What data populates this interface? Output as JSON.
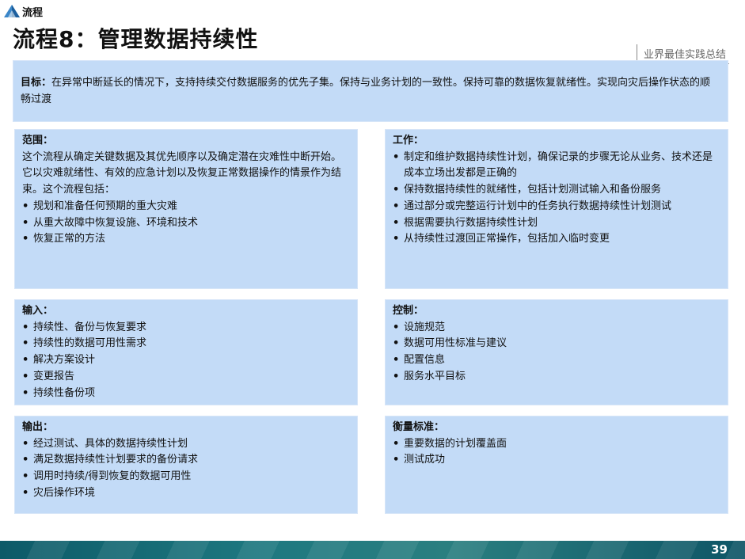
{
  "brand": {
    "text": "流程"
  },
  "title": "流程8：管理数据持续性",
  "best_practice_tag": "业界最佳实践总结",
  "goal": {
    "label": "目标：",
    "text": "在异常中断延长的情况下，支持持续交付数据服务的优先子集。保持与业务计划的一致性。保持可靠的数据恢复就绪性。实现向灾后操作状态的顺畅过渡"
  },
  "scope": {
    "label": "范围：",
    "text": "这个流程从确定关键数据及其优先顺序以及确定潜在灾难性中断开始。它以灾难就绪性、有效的应急计划以及恢复正常数据操作的情景作为结束。这个流程包括：",
    "items": [
      "规划和准备任何预期的重大灾难",
      "从重大故障中恢复设施、环境和技术",
      "恢复正常的方法"
    ]
  },
  "work": {
    "label": "工作：",
    "items": [
      "制定和维护数据持续性计划，确保记录的步骤无论从业务、技术还是成本立场出发都是正确的",
      "保持数据持续性的就绪性，包括计划测试输入和备份服务",
      "通过部分或完整运行计划中的任务执行数据持续性计划测试",
      "根据需要执行数据持续性计划",
      "从持续性过渡回正常操作，包括加入临时变更"
    ]
  },
  "input": {
    "label": "输入：",
    "items": [
      "持续性、备份与恢复要求",
      "持续性的数据可用性需求",
      "解决方案设计",
      "变更报告",
      "持续性备份项"
    ]
  },
  "control": {
    "label": "控制：",
    "items": [
      "设施规范",
      "数据可用性标准与建议",
      "配置信息",
      "服务水平目标"
    ]
  },
  "output": {
    "label": "输出：",
    "items": [
      "经过测试、具体的数据持续性计划",
      "满足数据持续性计划要求的备份请求",
      "调用时持续/得到恢复的数据可用性",
      "灾后操作环境"
    ]
  },
  "measure": {
    "label": "衡量标准：",
    "items": [
      "重要数据的计划覆盖面",
      "测试成功"
    ]
  },
  "page_number": "39",
  "colors": {
    "box_bg": "#c3dbf7",
    "footer": "#1e7880",
    "logo": "#3a86c8"
  }
}
